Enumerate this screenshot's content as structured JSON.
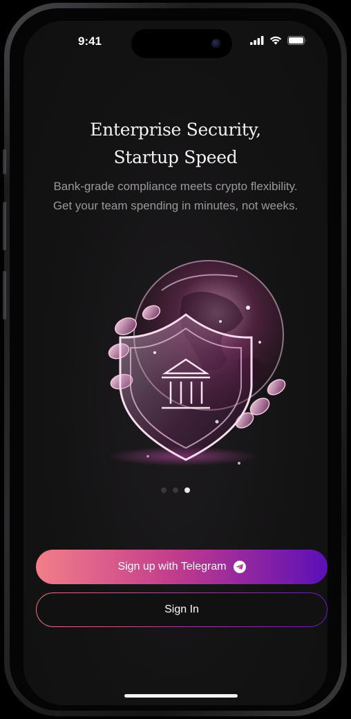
{
  "status_bar": {
    "time": "9:41"
  },
  "onboarding": {
    "title_line1": "Enterprise Security,",
    "title_line2": "Startup Speed",
    "subtitle_line1": "Bank-grade compliance meets crypto flexibility.",
    "subtitle_line2": "Get your team spending in minutes, not weeks.",
    "page_count": 3,
    "active_page": 3
  },
  "actions": {
    "primary_label": "Sign up with Telegram",
    "primary_icon": "telegram-icon",
    "secondary_label": "Sign In"
  },
  "colors": {
    "gradient_start": "#f27f8a",
    "gradient_mid": "#c13b8c",
    "gradient_end": "#5b0fb8",
    "background": "#141314"
  }
}
